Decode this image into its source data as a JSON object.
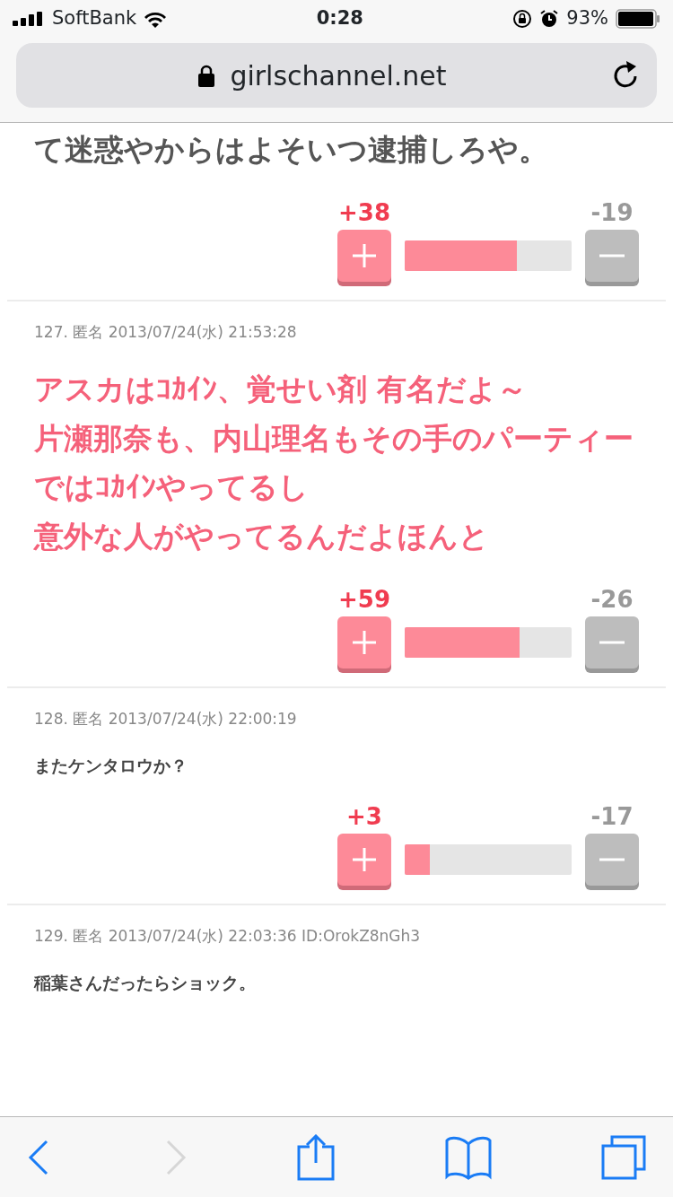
{
  "status_bar": {
    "carrier": "SoftBank",
    "time": "0:28",
    "battery": "93%"
  },
  "address_bar": {
    "url": "girlschannel.net"
  },
  "comments": [
    {
      "body": "て迷惑やからはよそいつ逮捕しろや。",
      "kind": "large",
      "votes": {
        "plus": "+38",
        "minus": "-19",
        "level": 0.67
      }
    },
    {
      "header": "127. 匿名 2013/07/24(水) 21:53:28",
      "body": "アスカはｺｶｲﾝ、覚せい剤 有名だよ～",
      "more_lines": [
        "片瀬那奈も、内山理名もその手のパーティーではｺｶｲﾝやってるし",
        "意外な人がやってるんだよほんと"
      ],
      "kind": "highlight",
      "votes": {
        "plus": "+59",
        "minus": "-26",
        "level": 0.69
      }
    },
    {
      "header": "128. 匿名 2013/07/24(水) 22:00:19",
      "body": "またケンタロウか？",
      "kind": "normal",
      "votes": {
        "plus": "+3",
        "minus": "-17",
        "level": 0.15
      }
    },
    {
      "header": "129. 匿名 2013/07/24(水) 22:03:36 ID:OrokZ8nGh3",
      "body": "稲葉さんだったらショック。",
      "kind": "normal"
    }
  ],
  "toolbar": {
    "forward_disabled": true
  }
}
